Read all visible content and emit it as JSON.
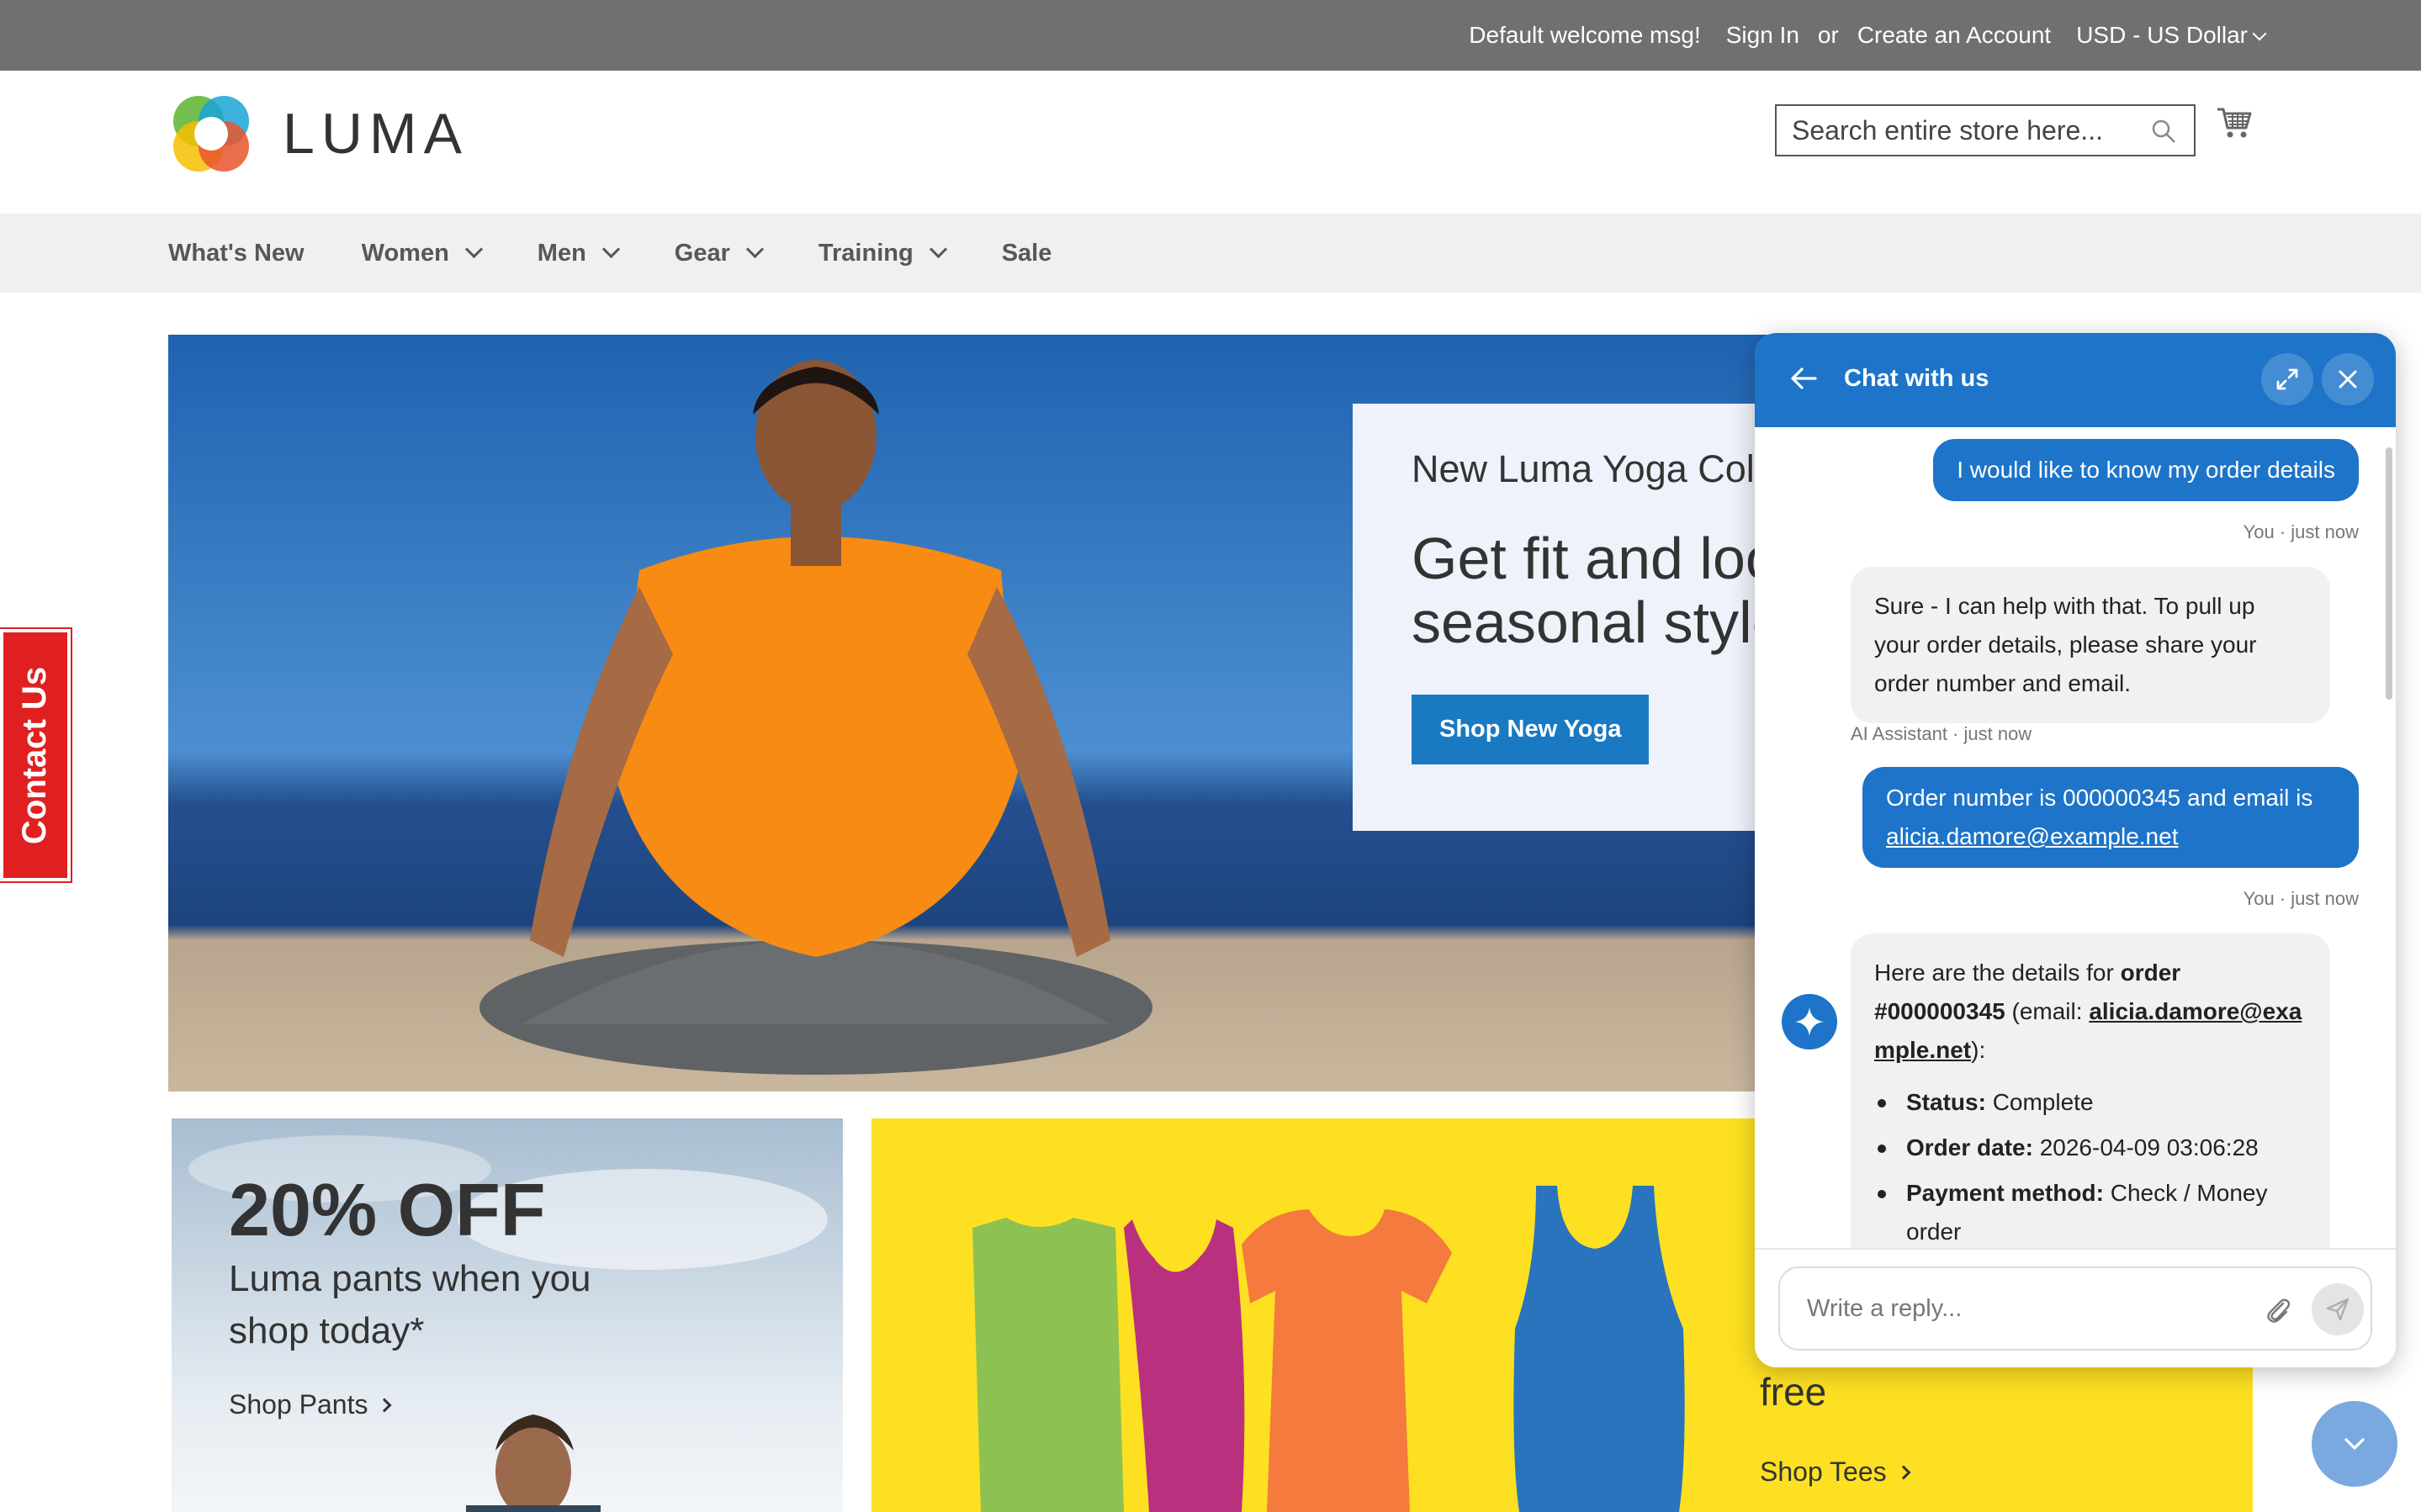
{
  "topbar": {
    "welcome": "Default welcome msg!",
    "sign_in": "Sign In",
    "or": "or",
    "create_account": "Create an Account",
    "currency": "USD - US Dollar"
  },
  "header": {
    "logo_text": "LUMA",
    "search_placeholder": "Search entire store here...",
    "icons": {
      "search": "search-icon",
      "cart": "cart-icon"
    }
  },
  "nav": {
    "items": [
      {
        "label": "What's New",
        "has_dropdown": false
      },
      {
        "label": "Women",
        "has_dropdown": true
      },
      {
        "label": "Men",
        "has_dropdown": true
      },
      {
        "label": "Gear",
        "has_dropdown": true
      },
      {
        "label": "Training",
        "has_dropdown": true
      },
      {
        "label": "Sale",
        "has_dropdown": false
      }
    ]
  },
  "hero": {
    "kicker": "New Luma Yoga Colle",
    "headline_line1": "Get fit and loo",
    "headline_line2": "seasonal styles",
    "button": "Shop New Yoga"
  },
  "promos": {
    "pants": {
      "headline": "20% OFF",
      "subline": "Luma pants when you shop today*",
      "cta": "Shop Pants"
    },
    "tees": {
      "text": "free",
      "cta": "Shop Tees"
    }
  },
  "contact_tab": {
    "label": "Contact Us"
  },
  "chat": {
    "title": "Chat with us",
    "messages": [
      {
        "role": "user",
        "text": "I would like to know my order details",
        "meta": "You · just now"
      },
      {
        "role": "assistant",
        "text": "Sure - I can help with that. To pull up your order details, please share your order number and email.",
        "meta": "AI Assistant · just now"
      },
      {
        "role": "user",
        "text_prefix": "Order number is 000000345 and email is ",
        "email": "alicia.damore@example.net",
        "meta": "You · just now"
      },
      {
        "role": "assistant",
        "intro_prefix": "Here are the details for ",
        "intro_order": "order #000000345",
        "intro_email_prefix": " (email: ",
        "intro_email": "alicia.damore@example.net",
        "intro_suffix": "):",
        "details": [
          {
            "label": "Status:",
            "value": "Complete"
          },
          {
            "label": "Order date:",
            "value": "2026-04-09 03:06:28"
          },
          {
            "label": "Payment method:",
            "value": "Check / Money order"
          }
        ]
      }
    ],
    "reply_placeholder": "Write a reply..."
  },
  "colors": {
    "topbar": "#6e716e",
    "nav_bg": "#f0f0f0",
    "brand_blue": "#1979c3",
    "chat_blue": "#1d74c9",
    "contact_red": "#e02020",
    "tees_yellow": "#fde021"
  }
}
